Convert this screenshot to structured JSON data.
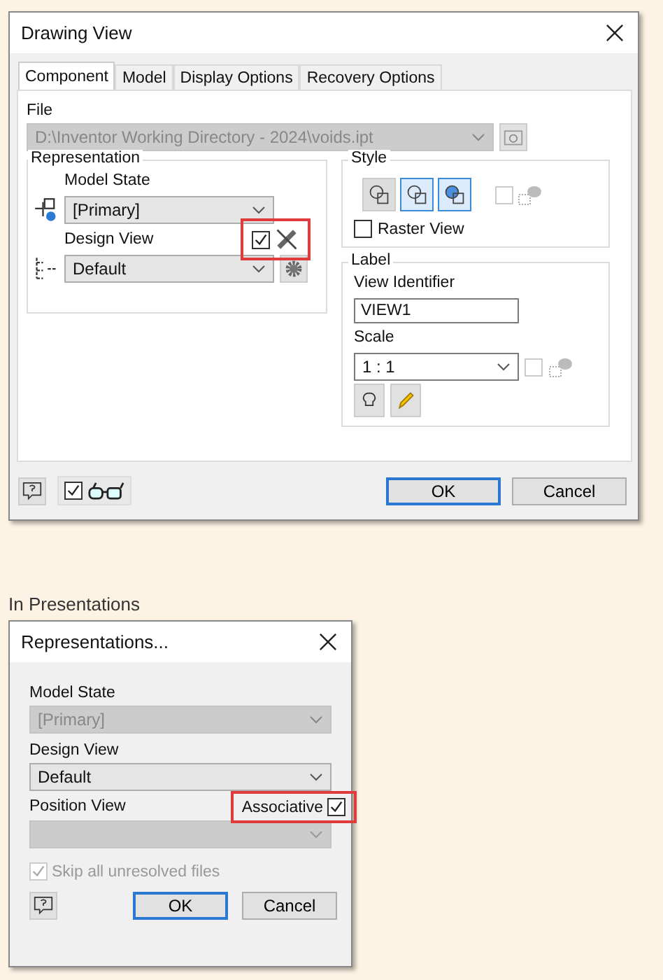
{
  "drawing_view": {
    "title": "Drawing View",
    "tabs": [
      {
        "label": "Component",
        "selected": true
      },
      {
        "label": "Model",
        "selected": false
      },
      {
        "label": "Display Options",
        "selected": false
      },
      {
        "label": "Recovery Options",
        "selected": false
      }
    ],
    "file": {
      "label": "File",
      "value": "D:\\Inventor Working Directory - 2024\\voids.ipt",
      "disabled": true
    },
    "representation": {
      "title": "Representation",
      "model_state": {
        "label": "Model State",
        "value": "[Primary]"
      },
      "design_view": {
        "label": "Design View",
        "value": "Default",
        "associative": {
          "checked": true,
          "highlighted": true
        }
      }
    },
    "style": {
      "title": "Style",
      "buttons": [
        {
          "selected": false
        },
        {
          "selected": true
        },
        {
          "selected": true
        }
      ],
      "style_from_base": {
        "checked": false,
        "disabled": true
      },
      "raster_view": {
        "label": "Raster View",
        "checked": false
      }
    },
    "label": {
      "title": "Label",
      "view_identifier": {
        "label": "View Identifier",
        "value": "VIEW1"
      },
      "scale": {
        "label": "Scale",
        "value": "1 : 1"
      },
      "scale_from_base": {
        "checked": false,
        "disabled": true
      }
    },
    "footer": {
      "preview_checkbox": {
        "checked": true
      },
      "buttons": [
        {
          "label": "OK",
          "default": true
        },
        {
          "label": "Cancel",
          "default": false
        }
      ]
    }
  },
  "section_heading": "In Presentations",
  "representations": {
    "title": "Representations...",
    "model_state": {
      "label": "Model State",
      "value": "[Primary]",
      "disabled": true
    },
    "design_view": {
      "label": "Design View",
      "value": "Default",
      "disabled": false
    },
    "associative": {
      "label": "Associative",
      "checked": true,
      "highlighted": true
    },
    "position_view": {
      "label": "Position View",
      "disabled": true
    },
    "skip_unresolved": {
      "label": "Skip all unresolved files",
      "checked": true,
      "disabled": true
    },
    "buttons": [
      {
        "label": "OK",
        "default": true
      },
      {
        "label": "Cancel",
        "default": false
      }
    ]
  }
}
